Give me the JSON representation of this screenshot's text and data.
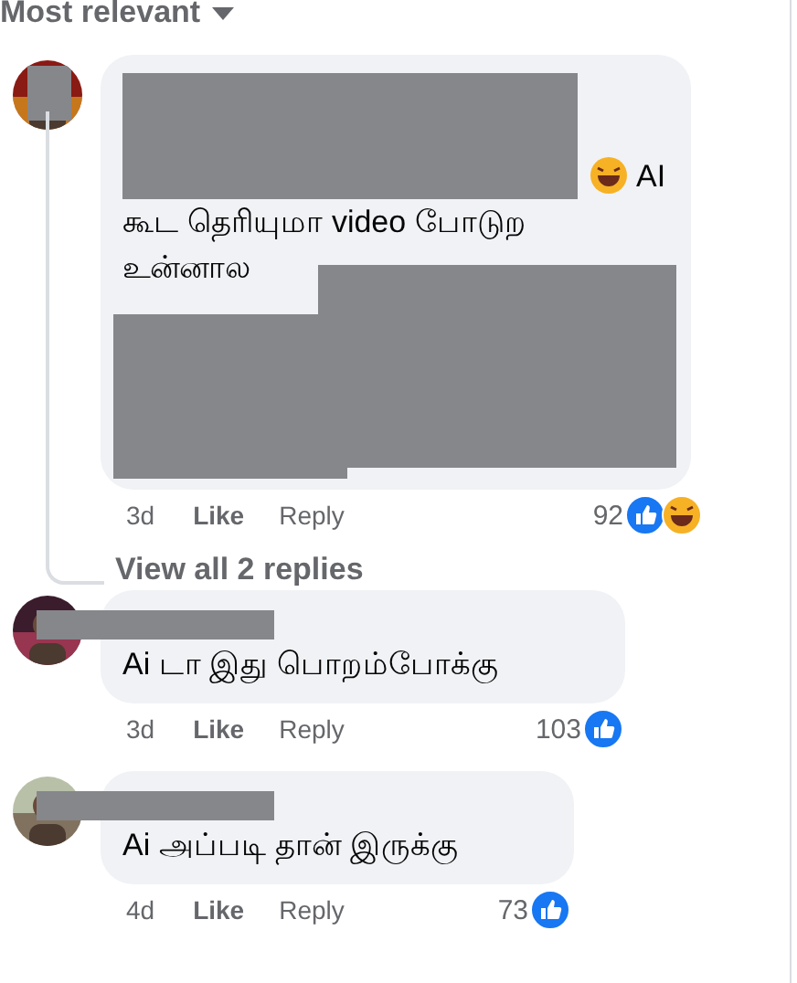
{
  "sort": {
    "label": "Most relevant"
  },
  "comments": [
    {
      "author_redacted": true,
      "avatar_redacted": true,
      "body_redacted": true,
      "lead_icon": {
        "kind": "haha"
      },
      "lines": [
        "AI",
        "கூட தெரியுமா video போடுற",
        "உன்னால"
      ],
      "time": "3d",
      "like": "Like",
      "reply": "Reply",
      "count": "92",
      "reactions": [
        {
          "kind": "like"
        },
        {
          "kind": "haha"
        }
      ],
      "replies_link": "View all 2 replies"
    },
    {
      "author_redacted": true,
      "avatar_redacted": false,
      "body_redacted": false,
      "lines": [
        "Ai டா இது பொறம்போக்கு"
      ],
      "time": "3d",
      "like": "Like",
      "reply": "Reply",
      "count": "103",
      "reactions": [
        {
          "kind": "like"
        }
      ]
    },
    {
      "author_redacted": true,
      "avatar_redacted": false,
      "body_redacted": false,
      "lines": [
        "Ai அப்படி தான் இருக்கு"
      ],
      "time": "4d",
      "like": "Like",
      "reply": "Reply",
      "count": "73",
      "reactions": [
        {
          "kind": "like"
        }
      ]
    }
  ]
}
